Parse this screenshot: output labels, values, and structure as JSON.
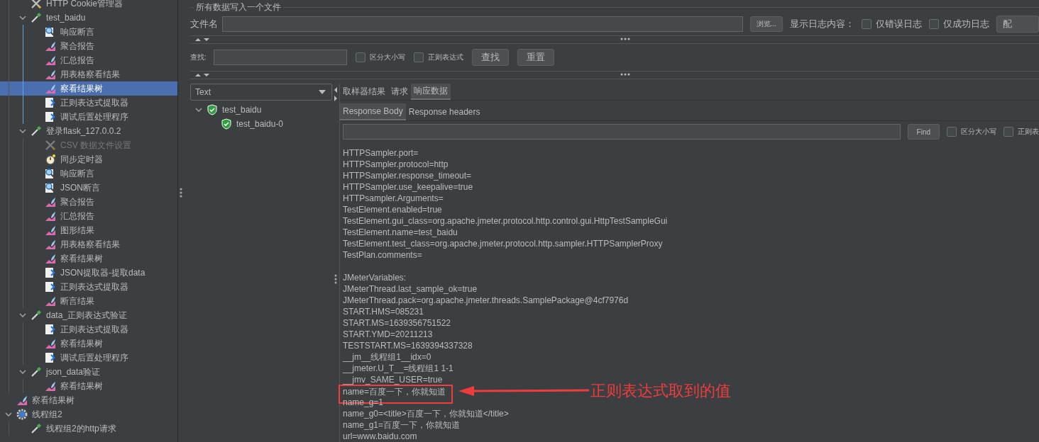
{
  "tree": {
    "continued_children": [
      {
        "kind": "config",
        "label": "HTTP Cookie管理器",
        "selected": false,
        "disabled": false
      },
      {
        "kind": "sampler",
        "label": "test_baidu",
        "expanded": true,
        "selected": false,
        "disabled": false,
        "children": [
          {
            "kind": "assertion",
            "label": "响应断言",
            "selected": false,
            "disabled": false
          },
          {
            "kind": "listener",
            "label": "聚合报告",
            "selected": false,
            "disabled": false
          },
          {
            "kind": "listener",
            "label": "汇总报告",
            "selected": false,
            "disabled": false
          },
          {
            "kind": "listener",
            "label": "用表格察看结果",
            "selected": false,
            "disabled": false
          },
          {
            "kind": "listener",
            "label": "察看结果树",
            "selected": true,
            "disabled": false
          },
          {
            "kind": "extractor",
            "label": "正则表达式提取器",
            "selected": false,
            "disabled": false
          },
          {
            "kind": "extractor",
            "label": "调试后置处理程序",
            "selected": false,
            "disabled": false
          }
        ]
      },
      {
        "kind": "sampler",
        "label": "登录flask_127.0.0.2",
        "expanded": true,
        "selected": false,
        "disabled": false,
        "children": [
          {
            "kind": "config",
            "label": "CSV 数据文件设置",
            "selected": false,
            "disabled": true
          },
          {
            "kind": "timer",
            "label": "同步定时器",
            "selected": false,
            "disabled": false
          },
          {
            "kind": "assertion",
            "label": "响应断言",
            "selected": false,
            "disabled": false
          },
          {
            "kind": "assertion",
            "label": "JSON断言",
            "selected": false,
            "disabled": false
          },
          {
            "kind": "listener",
            "label": "聚合报告",
            "selected": false,
            "disabled": false
          },
          {
            "kind": "listener",
            "label": "汇总报告",
            "selected": false,
            "disabled": false
          },
          {
            "kind": "listener",
            "label": "图形结果",
            "selected": false,
            "disabled": false
          },
          {
            "kind": "listener",
            "label": "用表格察看结果",
            "selected": false,
            "disabled": false
          },
          {
            "kind": "listener",
            "label": "察看结果树",
            "selected": false,
            "disabled": false
          },
          {
            "kind": "extractor",
            "label": "JSON提取器-提取data",
            "selected": false,
            "disabled": false
          },
          {
            "kind": "extractor",
            "label": "正则表达式提取器",
            "selected": false,
            "disabled": false
          },
          {
            "kind": "listener",
            "label": "断言结果",
            "selected": false,
            "disabled": false
          }
        ]
      },
      {
        "kind": "sampler",
        "label": "data_正则表达式验证",
        "expanded": true,
        "selected": false,
        "disabled": false,
        "children": [
          {
            "kind": "extractor",
            "label": "正则表达式提取器",
            "selected": false,
            "disabled": false
          },
          {
            "kind": "listener",
            "label": "察看结果树",
            "selected": false,
            "disabled": false
          },
          {
            "kind": "extractor",
            "label": "调试后置处理程序",
            "selected": false,
            "disabled": false
          }
        ]
      },
      {
        "kind": "sampler",
        "label": "json_data验证",
        "expanded": true,
        "selected": false,
        "disabled": false,
        "children": [
          {
            "kind": "listener",
            "label": "察看结果树",
            "selected": false,
            "disabled": false
          }
        ]
      }
    ],
    "items": [
      {
        "kind": "listener",
        "label": "察看结果树",
        "selected": false,
        "disabled": false
      },
      {
        "kind": "threadgroup",
        "label": "线程组2",
        "expanded": true,
        "selected": false,
        "disabled": false,
        "children": [
          {
            "kind": "sampler",
            "label": "线程组2的http请求",
            "selected": false,
            "disabled": false
          }
        ]
      }
    ]
  },
  "file_section": {
    "title": "所有数据写入一个文件",
    "filename_label": "文件名",
    "browse_button": "浏览...",
    "log_label": "显示日志内容：",
    "checkboxes": [
      {
        "label": "仅错误日志",
        "checked": false
      },
      {
        "label": "仅成功日志",
        "checked": false
      }
    ],
    "config_button": "配"
  },
  "search": {
    "label": "查找:",
    "checkboxes": [
      {
        "label": "区分大小写",
        "checked": false
      },
      {
        "label": "正则表达式",
        "checked": false
      }
    ],
    "buttons": [
      "查找",
      "重置"
    ]
  },
  "results": {
    "renderer": "Text",
    "items": [
      {
        "label": "test_baidu",
        "kind": "success",
        "expanded": true,
        "selected": false,
        "children": [
          {
            "label": "test_baidu-0",
            "kind": "success",
            "selected": false
          }
        ]
      }
    ]
  },
  "tabs": [
    {
      "label": "取样器结果",
      "selected": false
    },
    {
      "label": "请求",
      "selected": false
    },
    {
      "label": "响应数据",
      "selected": true
    }
  ],
  "subtabs": [
    {
      "label": "Response Body",
      "selected": true
    },
    {
      "label": "Response headers",
      "selected": false
    }
  ],
  "find": {
    "button": "Find",
    "checkboxes": [
      {
        "label": "区分大小写",
        "checked": false
      },
      {
        "label": "正则表",
        "checked": false
      }
    ]
  },
  "response_sections": [
    [
      {
        "text": "HTTPSampler.port="
      },
      {
        "text": "HTTPSampler.protocol=http"
      },
      {
        "text": "HTTPSampler.response_timeout="
      },
      {
        "text": "HTTPSampler.use_keepalive=true"
      },
      {
        "text": "HTTPsampler.Arguments="
      },
      {
        "text": "TestElement.enabled=true"
      },
      {
        "text": "TestElement.gui_class=org.apache.jmeter.protocol.http.control.gui.HttpTestSampleGui"
      },
      {
        "text": "TestElement.name=test_baidu"
      },
      {
        "text": "TestElement.test_class=org.apache.jmeter.protocol.http.sampler.HTTPSamplerProxy"
      },
      {
        "text": "TestPlan.comments="
      }
    ],
    [
      {
        "text": "JMeterVariables:"
      },
      {
        "text": "JMeterThread.last_sample_ok=true"
      },
      {
        "text": "JMeterThread.pack=org.apache.jmeter.threads.SamplePackage@4cf7976d"
      },
      {
        "text": "START.HMS=085231"
      },
      {
        "text": "START.MS=1639356751522"
      },
      {
        "text": "START.YMD=20211213"
      },
      {
        "text": "TESTSTART.MS=1639394337328"
      },
      {
        "text": "__jm__线程组1__idx=0"
      },
      {
        "text": "__jmeter.U_T__=线程组1 1-1"
      },
      {
        "text": "__jmv_SAME_USER=true"
      },
      {
        "text": "name=百度一下，你就知道",
        "boxed": true
      },
      {
        "text": "name_g=1"
      },
      {
        "text": "name_g0=<title>百度一下，你就知道</title>"
      },
      {
        "text": "name_g1=百度一下，你就知道"
      },
      {
        "text": "url=www.baidu.com"
      }
    ]
  ],
  "annotation": "正则表达式取到的值"
}
